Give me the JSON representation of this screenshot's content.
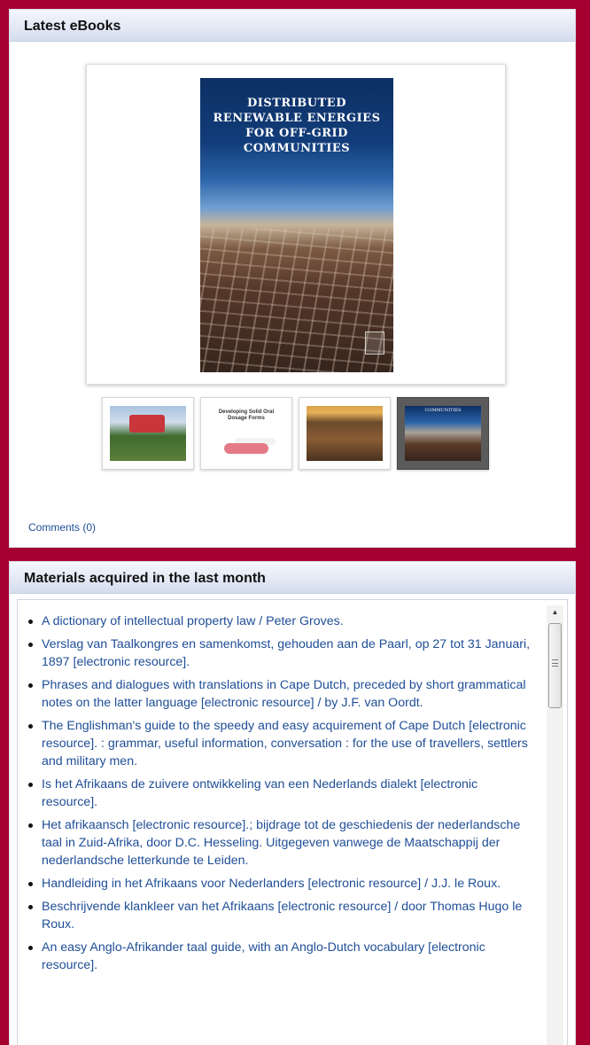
{
  "ebooks_panel": {
    "title": "Latest eBooks",
    "featured_cover": {
      "title": "DISTRIBUTED RENEWABLE ENERGIES FOR OFF-GRID COMMUNITIES"
    },
    "thumbnails": [
      {
        "id": "ebook-1",
        "text": ""
      },
      {
        "id": "ebook-2",
        "text": "Developing Solid Oral Dosage Forms"
      },
      {
        "id": "ebook-3",
        "text": ""
      },
      {
        "id": "ebook-4",
        "text": "COMMUNITIES",
        "selected": true
      }
    ],
    "comments_link": "Comments (0)"
  },
  "materials_panel": {
    "title": "Materials acquired in the last month",
    "items": [
      "A dictionary of intellectual property law / Peter Groves.",
      "Verslag van Taalkongres en samenkomst, gehouden aan de Paarl, op 27 tot 31 Januari, 1897 [electronic resource].",
      "Phrases and dialogues with translations in Cape Dutch, preceded by short grammatical notes on the latter language [electronic resource] / by J.F. van Oordt.",
      "The Englishman's guide to the speedy and easy acquirement of Cape Dutch [electronic resource]. : grammar, useful information, conversation : for the use of travellers, settlers and military men.",
      "Is het Afrikaans de zuivere ontwikkeling van een Nederlands dialekt [electronic resource].",
      "Het afrikaansch [electronic resource].; bijdrage tot de geschiedenis der nederlandsche taal in Zuid-Afrika, door D.C. Hesseling. Uitgegeven vanwege de Maatschappij der nederlandsche letterkunde te Leiden.",
      "Handleiding in het Afrikaans voor Nederlanders [electronic resource] / J.J. le Roux.",
      "Beschrijvende klankleer van het Afrikaans [electronic resource] / door Thomas Hugo le Roux.",
      "An easy Anglo-Afrikander taal guide, with an Anglo-Dutch vocabulary [electronic resource]."
    ]
  },
  "colors": {
    "page_background": "#a5002f",
    "link": "#1f4e96",
    "header_gradient_top": "#f4f7fc",
    "header_gradient_bottom": "#d4dcee"
  }
}
